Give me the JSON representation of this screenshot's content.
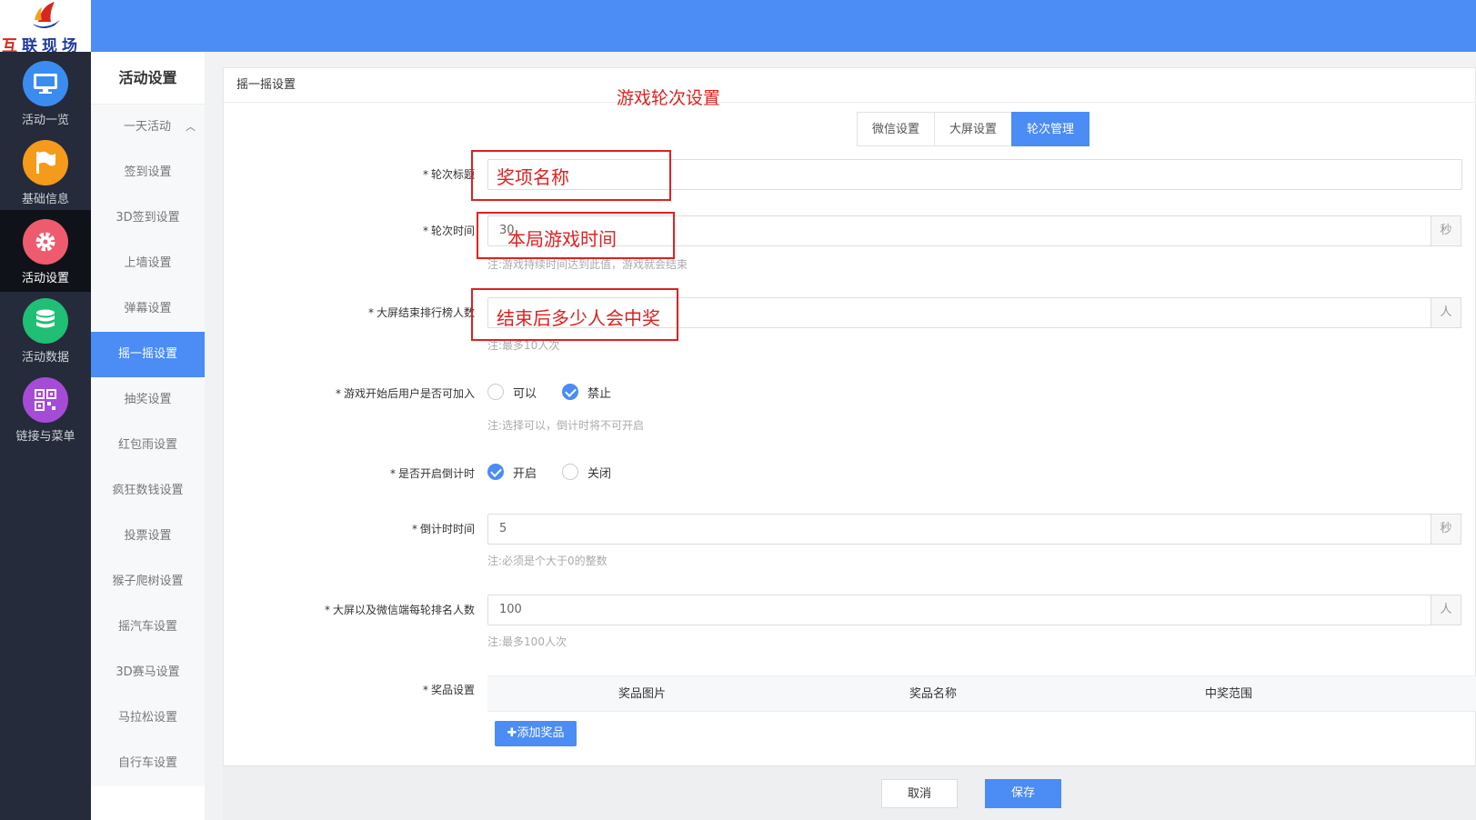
{
  "brand": {
    "logo_text": "互联现场",
    "logo_c1": "互",
    "logo_rest": "联现场"
  },
  "leftnav": [
    {
      "label": "活动一览",
      "icon": "monitor-icon",
      "color": "#3b8cf0"
    },
    {
      "label": "基础信息",
      "icon": "flag-icon",
      "color": "#f59a1b"
    },
    {
      "label": "活动设置",
      "icon": "gear-icon",
      "color": "#ef5b6e"
    },
    {
      "label": "活动数据",
      "icon": "database-icon",
      "color": "#1fbf75"
    },
    {
      "label": "链接与菜单",
      "icon": "qrcode-icon",
      "color": "#a64bd6"
    }
  ],
  "submenu": {
    "title": "活动设置",
    "group": "一天活动",
    "items": [
      "签到设置",
      "3D签到设置",
      "上墙设置",
      "弹幕设置",
      "摇一摇设置",
      "抽奖设置",
      "红包雨设置",
      "疯狂数钱设置",
      "投票设置",
      "猴子爬树设置",
      "摇汽车设置",
      "3D赛马设置",
      "马拉松设置",
      "自行车设置"
    ]
  },
  "panel": {
    "title": "摇一摇设置",
    "annotation_heading": "游戏轮次设置",
    "tabs": [
      "微信设置",
      "大屏设置",
      "轮次管理"
    ]
  },
  "form": {
    "round_title": {
      "label": "轮次标题",
      "value": "",
      "annotation": "奖项名称"
    },
    "round_time": {
      "label": "轮次时间",
      "value": "30",
      "unit": "秒",
      "hint": "注:游戏持续时间达到此值，游戏就会结束",
      "annotation": "本局游戏时间"
    },
    "rank_count": {
      "label": "大屏结束排行榜人数",
      "value": "",
      "unit": "人",
      "hint": "注:最多10人次",
      "annotation": "结束后多少人会中奖"
    },
    "join_after_start": {
      "label": "游戏开始后用户是否可加入",
      "options": [
        "可以",
        "禁止"
      ],
      "hint": "注:选择可以，倒计时将不可开启"
    },
    "countdown_enable": {
      "label": "是否开启倒计时",
      "options": [
        "开启",
        "关闭"
      ]
    },
    "countdown_time": {
      "label": "倒计时时间",
      "value": "5",
      "unit": "秒",
      "hint": "注:必须是个大于0的整数"
    },
    "rank_per_round": {
      "label": "大屏以及微信端每轮排名人数",
      "value": "100",
      "unit": "人",
      "hint": "注:最多100人次"
    },
    "prize": {
      "label": "奖品设置",
      "columns": [
        "奖品图片",
        "奖品名称",
        "中奖范围"
      ],
      "add_button": "✚添加奖品"
    }
  },
  "footer": {
    "cancel": "取消",
    "save": "保存"
  },
  "colors": {
    "primary": "#4b8cf5",
    "annotation": "#e02020",
    "nav_bg": "#252b3a"
  }
}
